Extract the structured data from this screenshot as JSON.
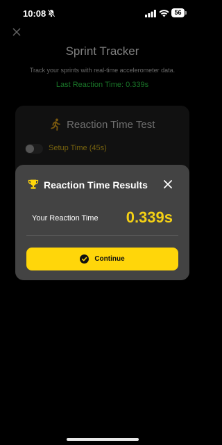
{
  "status_bar": {
    "time": "10:08",
    "battery": "56"
  },
  "page": {
    "title": "Sprint Tracker",
    "subtitle": "Track your sprints with real-time accelerometer data.",
    "last_reaction": "Last Reaction Time: 0.339s"
  },
  "card": {
    "title": "Reaction Time Test",
    "toggle_label": "Setup Time (45s)",
    "toggle_on": false
  },
  "modal": {
    "title": "Reaction Time Results",
    "result_label": "Your Reaction Time",
    "result_value": "0.339s",
    "continue_label": "Continue"
  },
  "colors": {
    "accent_yellow": "#ffd60a",
    "value_yellow": "#f5d114",
    "success_green": "#2fd64a",
    "modal_bg": "#434343"
  },
  "icons": [
    "bell-slash-icon",
    "signal-icon",
    "wifi-icon",
    "battery-icon",
    "close-icon",
    "runner-icon",
    "trophy-icon",
    "check-circle-icon"
  ]
}
